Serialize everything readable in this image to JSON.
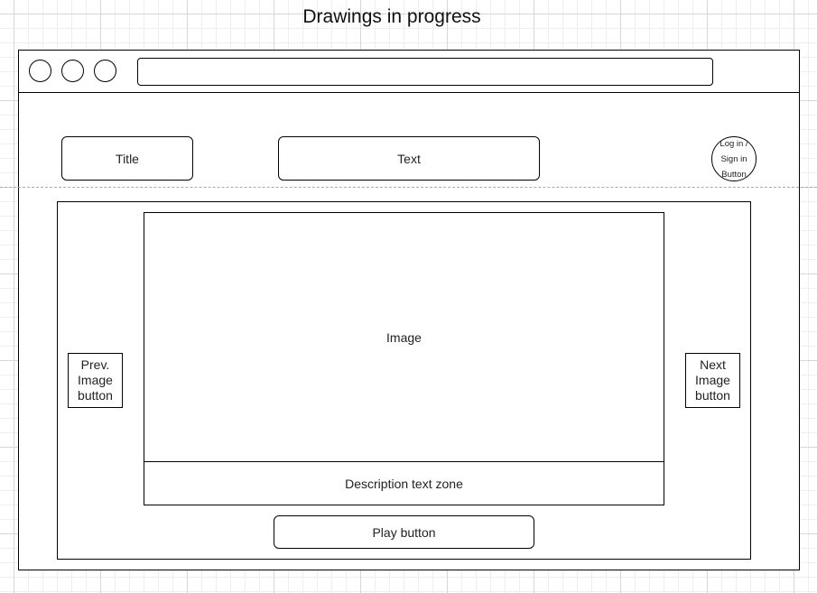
{
  "diagram": {
    "title": "Drawings in progress"
  },
  "window": {
    "header": {
      "title_box": "Title",
      "text_box": "Text",
      "login_button": [
        "Log in /",
        "Sign in",
        "Button"
      ]
    },
    "content": {
      "image_box": "Image",
      "description_zone": "Description text zone",
      "play_button": "Play button",
      "prev_button": [
        "Prev.",
        "Image",
        "button"
      ],
      "next_button": [
        "Next",
        "Image",
        "button"
      ]
    }
  }
}
